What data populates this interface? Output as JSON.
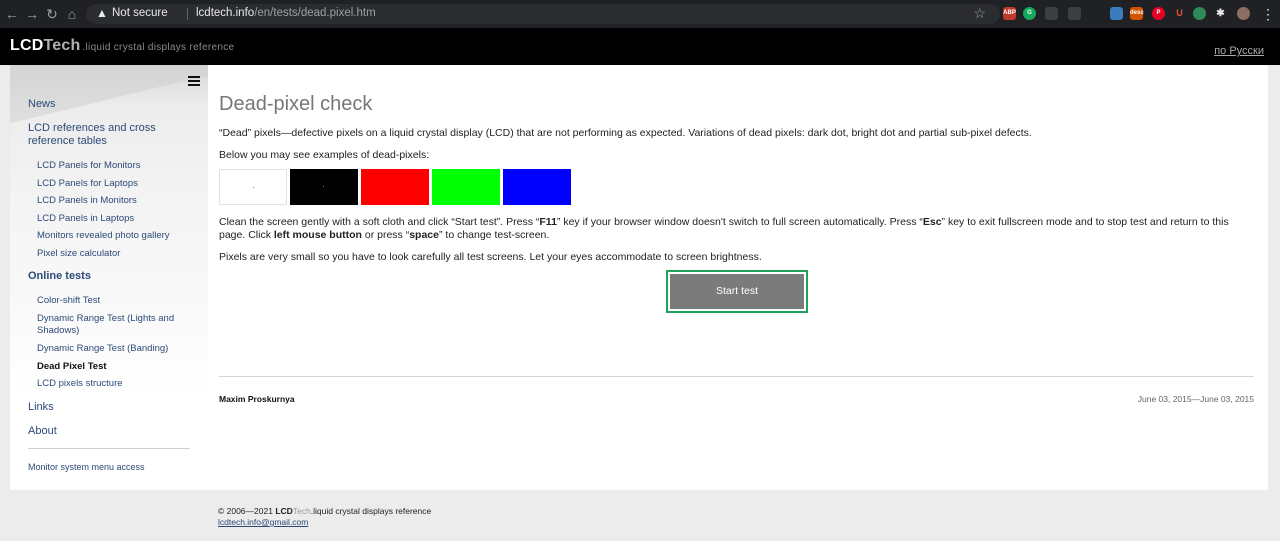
{
  "browser": {
    "security_label": "Not secure",
    "url_host": "lcdtech.info",
    "url_path": "/en/tests/dead.pixel.htm"
  },
  "site": {
    "logo_main": "LCD",
    "logo_tech": "Tech",
    "logo_sub": ".liquid crystal displays reference",
    "lang_link": "по Русски"
  },
  "sidebar": {
    "news": "News",
    "lcd_ref": "LCD references and cross reference tables",
    "ref_items": [
      "LCD Panels for Monitors",
      "LCD Panels for Laptops",
      "LCD Panels in Monitors",
      "LCD Panels in Laptops",
      "Monitors revealed photo gallery",
      "Pixel size calculator"
    ],
    "online_tests": "Online tests",
    "test_items": [
      "Color-shift Test",
      "Dynamic Range Test (Lights and Shadows)",
      "Dynamic Range Test (Banding)",
      "Dead Pixel Test",
      "LCD pixels structure"
    ],
    "links": "Links",
    "about": "About",
    "footer_link": "Monitor system menu access"
  },
  "main": {
    "title": "Dead-pixel check",
    "intro": "“Dead” pixels—defective pixels on a liquid crystal display (LCD) that are not performing as expected. Variations of dead pixels: dark dot, bright dot and partial sub-pixel defects.",
    "examples_label": "Below you may see examples of dead-pixels:",
    "swatch_colors": [
      "#ffffff",
      "#000000",
      "#ff0000",
      "#00ff00",
      "#0000ff"
    ],
    "instr_1": "Clean the screen gently with a soft cloth and click “Start test”. Press “",
    "instr_f11": "F11",
    "instr_2": "” key if your browser window doesn't switch to full screen automatically. Press “",
    "instr_esc": "Esc",
    "instr_3": "” key to exit fullscreen mode and to stop test and return to this page. Click ",
    "instr_lmb": "left mouse button",
    "instr_4": " or press “",
    "instr_space": "space",
    "instr_5": "” to change test-screen.",
    "pixels_note": "Pixels are very small so you have to look carefully all test screens. Let your eyes accommodate to screen brightness.",
    "start_button": "Start test",
    "author": "Maxim Proskurnya",
    "date": "June 03, 2015—June 03, 2015"
  },
  "footer": {
    "copyright": "© 2006—2021 ",
    "brand_lcd": "LCD",
    "brand_tech": "Tech",
    "brand_sub": ".liquid crystal displays reference",
    "email": "lcdtech.info@gmail.com"
  },
  "colors": {
    "accent_border": "#22a15a",
    "button_bg": "#7b7b7b",
    "link": "#2c4a78"
  }
}
